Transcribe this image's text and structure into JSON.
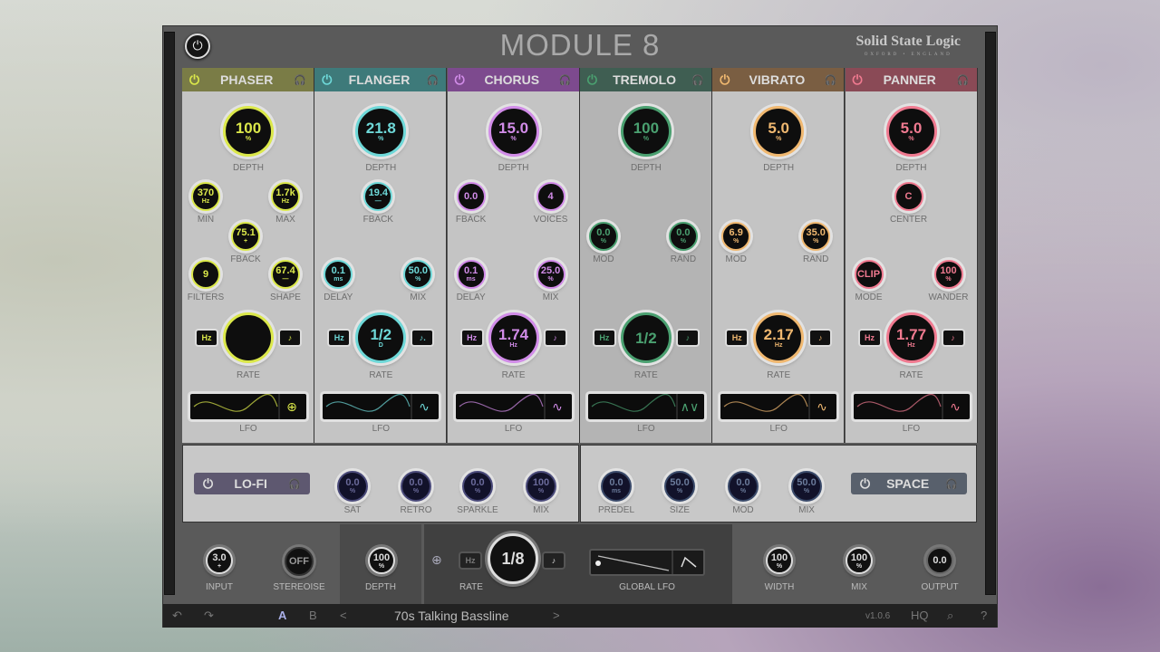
{
  "app": {
    "title": "MODULE 8",
    "brand": "Solid State Logic",
    "brand_sub": "OXFORD • ENGLAND"
  },
  "modules": [
    {
      "id": "phaser",
      "name": "PHASER",
      "color": "#dbe84a",
      "head": "#7a7c46",
      "depth": {
        "value": "100",
        "unit": "%",
        "label": "DEPTH"
      },
      "knobs": [
        {
          "v": "370",
          "u": "Hz",
          "l": "MIN"
        },
        {
          "v": "1.7k",
          "u": "Hz",
          "l": "MAX"
        },
        {
          "v": "75.1",
          "u": "+",
          "l": "FBACK"
        },
        {
          "v": "9",
          "u": "",
          "l": "FILTERS"
        },
        {
          "v": "67.4",
          "u": "—",
          "l": "SHAPE"
        }
      ],
      "rate": {
        "value": "",
        "unit": "",
        "label": "RATE",
        "hz": "Hz",
        "note": "♪"
      },
      "lfo_label": "LFO",
      "lfo_icon": "⊕"
    },
    {
      "id": "flanger",
      "name": "FLANGER",
      "color": "#6ed8d8",
      "head": "#3e7a7a",
      "depth": {
        "value": "21.8",
        "unit": "%",
        "label": "DEPTH"
      },
      "knobs": [
        {
          "v": "19.4",
          "u": "—",
          "l": "FBACK"
        },
        {
          "v": "0.1",
          "u": "ms",
          "l": "DELAY"
        },
        {
          "v": "50.0",
          "u": "%",
          "l": "MIX"
        }
      ],
      "rate": {
        "value": "1/2",
        "unit": "D",
        "label": "RATE",
        "hz": "Hz",
        "note": "♪."
      },
      "lfo_label": "LFO",
      "lfo_icon": "∿"
    },
    {
      "id": "chorus",
      "name": "CHORUS",
      "color": "#d18ce8",
      "head": "#7d4a8e",
      "depth": {
        "value": "15.0",
        "unit": "%",
        "label": "DEPTH"
      },
      "knobs": [
        {
          "v": "0.0",
          "u": "",
          "l": "FBACK"
        },
        {
          "v": "4",
          "u": "",
          "l": "VOICES"
        },
        {
          "v": "0.1",
          "u": "ms",
          "l": "DELAY"
        },
        {
          "v": "25.0",
          "u": "%",
          "l": "MIX"
        }
      ],
      "rate": {
        "value": "1.74",
        "unit": "Hz",
        "label": "RATE",
        "hz": "Hz",
        "note": "♪"
      },
      "lfo_label": "LFO",
      "lfo_icon": "∿"
    },
    {
      "id": "tremolo",
      "name": "TREMOLO",
      "color": "#4aa070",
      "head": "#3f5e52",
      "depth": {
        "value": "100",
        "unit": "%",
        "label": "DEPTH"
      },
      "knobs": [
        {
          "v": "0.0",
          "u": "%",
          "l": "MOD"
        },
        {
          "v": "0.0",
          "u": "%",
          "l": "RAND"
        }
      ],
      "rate": {
        "value": "1/2",
        "unit": "",
        "label": "RATE",
        "hz": "Hz",
        "note": "♪"
      },
      "lfo_label": "LFO",
      "lfo_icon": "∧∨"
    },
    {
      "id": "vibrato",
      "name": "VIBRATO",
      "color": "#f0b870",
      "head": "#7a5e42",
      "depth": {
        "value": "5.0",
        "unit": "%",
        "label": "DEPTH"
      },
      "knobs": [
        {
          "v": "6.9",
          "u": "%",
          "l": "MOD"
        },
        {
          "v": "35.0",
          "u": "%",
          "l": "RAND"
        }
      ],
      "rate": {
        "value": "2.17",
        "unit": "Hz",
        "label": "RATE",
        "hz": "Hz",
        "note": "♪"
      },
      "lfo_label": "LFO",
      "lfo_icon": "∿"
    },
    {
      "id": "panner",
      "name": "PANNER",
      "color": "#f07a90",
      "head": "#8a4a56",
      "depth": {
        "value": "5.0",
        "unit": "%",
        "label": "DEPTH"
      },
      "knobs": [
        {
          "v": "C",
          "u": "",
          "l": "CENTER"
        },
        {
          "v": "CLIP",
          "u": "",
          "l": "MODE"
        },
        {
          "v": "100",
          "u": "%",
          "l": "WANDER"
        }
      ],
      "rate": {
        "value": "1.77",
        "unit": "Hz",
        "label": "RATE",
        "hz": "Hz",
        "note": "♪"
      },
      "lfo_label": "LFO",
      "lfo_icon": "∿"
    }
  ],
  "lofi": {
    "name": "LO-FI",
    "knobs": [
      {
        "v": "0.0",
        "u": "%",
        "l": "SAT"
      },
      {
        "v": "0.0",
        "u": "%",
        "l": "RETRO"
      },
      {
        "v": "0.0",
        "u": "%",
        "l": "SPARKLE"
      },
      {
        "v": "100",
        "u": "%",
        "l": "MIX"
      }
    ]
  },
  "space": {
    "name": "SPACE",
    "knobs": [
      {
        "v": "0.0",
        "u": "ms",
        "l": "PREDEL"
      },
      {
        "v": "50.0",
        "u": "%",
        "l": "SIZE"
      },
      {
        "v": "0.0",
        "u": "%",
        "l": "MOD"
      },
      {
        "v": "50.0",
        "u": "%",
        "l": "MIX"
      }
    ]
  },
  "global": {
    "input": {
      "v": "3.0",
      "u": "+",
      "l": "INPUT"
    },
    "stereoise": {
      "v": "OFF",
      "l": "STEREOISE"
    },
    "depth": {
      "v": "100",
      "u": "%",
      "l": "DEPTH"
    },
    "rate": {
      "v": "1/8",
      "l": "RATE",
      "hz": "Hz",
      "note": "♪"
    },
    "global_lfo": "GLOBAL LFO",
    "width": {
      "v": "100",
      "u": "%",
      "l": "WIDTH"
    },
    "mix": {
      "v": "100",
      "u": "%",
      "l": "MIX"
    },
    "output": {
      "v": "0.0",
      "u": "",
      "l": "OUTPUT"
    }
  },
  "footer": {
    "undo": "↶",
    "redo": "↷",
    "a": "A",
    "b": "B",
    "prev": "<",
    "preset": "70s Talking Bassline",
    "next": ">",
    "version": "v1.0.6",
    "hq": "HQ",
    "search": "⌕",
    "help": "?"
  }
}
